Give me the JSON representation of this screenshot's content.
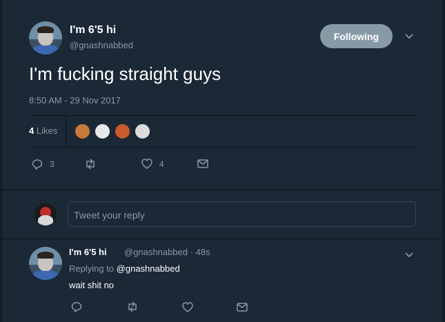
{
  "tweet": {
    "display_name": "I'm 6'5 hi",
    "handle": "@gnashnabbed",
    "follow_label": "Following",
    "text": "I'm fucking straight guys",
    "timestamp": "8:50 AM - 29 Nov 2017",
    "likes_count": "4",
    "likes_label": "Likes",
    "reply_count": "3",
    "like_count_action": "4"
  },
  "reply_composer": {
    "placeholder": "Tweet your reply"
  },
  "reply": {
    "display_name": "I'm 6'5 hi",
    "handle_time": "@gnashnabbed · 48s",
    "replying_prefix": "Replying to",
    "replying_handle": "@gnashnabbed",
    "text": "wait shit no"
  },
  "colors": {
    "background": "#141d26",
    "panel": "#1b2836",
    "muted": "#8899a6",
    "button": "#8899a6"
  }
}
